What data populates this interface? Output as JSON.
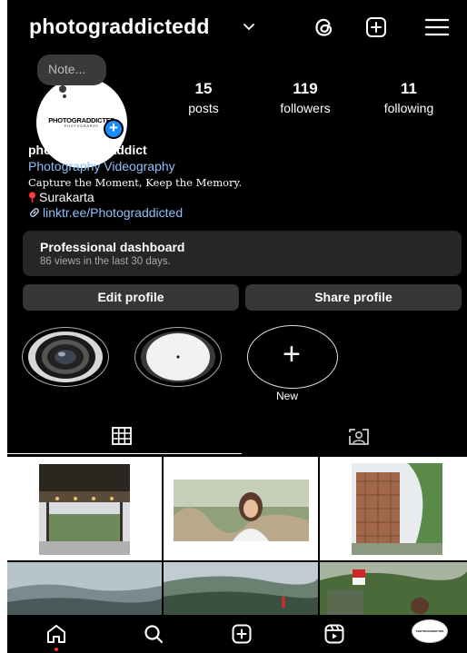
{
  "header": {
    "username": "photograddictedd",
    "icons": [
      "chevron-down-icon",
      "threads-icon",
      "add-post-icon",
      "menu-icon"
    ]
  },
  "profile": {
    "note": "Note...",
    "avatar_logo": "PHOTOGRADDICTED",
    "avatar_logo_sub": "PHOTOGRAPHY",
    "stats": [
      {
        "value": "15",
        "label": "posts"
      },
      {
        "value": "119",
        "label": "followers"
      },
      {
        "value": "11",
        "label": "following"
      }
    ],
    "bio": {
      "name": "photography addict",
      "category": "Photography Videography",
      "text": "Capture the Moment, Keep the Memory.",
      "location": "Surakarta",
      "link": "linktr.ee/Photograddicted"
    }
  },
  "dashboard": {
    "title": "Professional dashboard",
    "subtitle": "86 views in the last 30 days."
  },
  "buttons": {
    "edit": "Edit profile",
    "share": "Share profile"
  },
  "highlights": {
    "new_label": "New"
  },
  "tabs": [
    "grid-icon",
    "tagged-icon"
  ],
  "nav": {
    "icons": [
      "home-icon",
      "search-icon",
      "create-icon",
      "reels-icon",
      "profile-avatar"
    ]
  },
  "colors": {
    "background": "#000000",
    "link": "#8fbff7",
    "badge": "#1a8cff",
    "button": "#363636",
    "card": "#262626",
    "notification_dot": "#ff3040"
  }
}
